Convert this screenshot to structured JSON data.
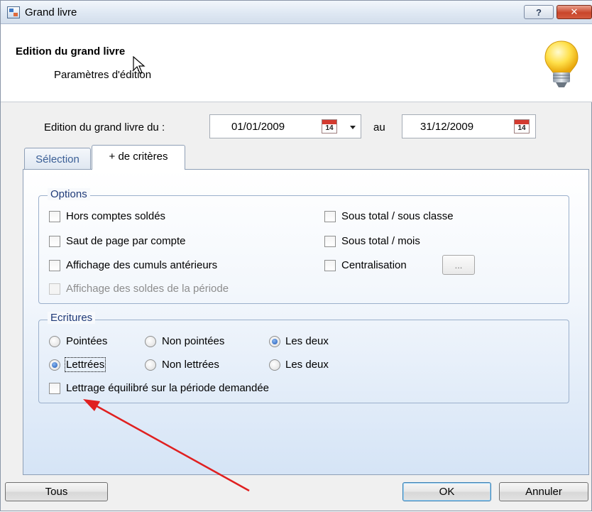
{
  "window": {
    "title": "Grand livre"
  },
  "header": {
    "title": "Edition du grand livre",
    "subtitle": "Paramètres d'édition"
  },
  "date_range": {
    "label_from": "Edition du grand livre du :",
    "from": "01/01/2009",
    "label_to": "au",
    "to": "31/12/2009",
    "calendar_day": "14"
  },
  "tabs": [
    {
      "label": "Sélection",
      "active": false
    },
    {
      "label": "+ de critères",
      "active": true
    }
  ],
  "options": {
    "legend": "Options",
    "items": [
      {
        "label": "Hors comptes soldés",
        "checked": false,
        "enabled": true
      },
      {
        "label": "Saut de page par compte",
        "checked": false,
        "enabled": true
      },
      {
        "label": "Affichage des cumuls antérieurs",
        "checked": false,
        "enabled": true
      },
      {
        "label": "Affichage des soldes de la période",
        "checked": false,
        "enabled": false
      },
      {
        "label": "Sous total / sous classe",
        "checked": false,
        "enabled": true
      },
      {
        "label": "Sous total / mois",
        "checked": false,
        "enabled": true
      },
      {
        "label": "Centralisation",
        "checked": false,
        "enabled": true
      }
    ],
    "ellipsis_label": "..."
  },
  "ecritures": {
    "legend": "Ecritures",
    "row1": [
      {
        "label": "Pointées",
        "selected": false
      },
      {
        "label": "Non pointées",
        "selected": false
      },
      {
        "label": "Les deux",
        "selected": true
      }
    ],
    "row2": [
      {
        "label": "Lettrées",
        "selected": true
      },
      {
        "label": "Non lettrées",
        "selected": false
      },
      {
        "label": "Les deux",
        "selected": false
      }
    ],
    "balanced_label": "Lettrage équilibré sur la période demandée"
  },
  "footer": {
    "all_label": "Tous",
    "ok_label": "OK",
    "cancel_label": "Annuler"
  },
  "colors": {
    "annotation_arrow": "#e02020",
    "legend_text": "#1f3a78",
    "tab_inactive_text": "#3b5f96"
  }
}
